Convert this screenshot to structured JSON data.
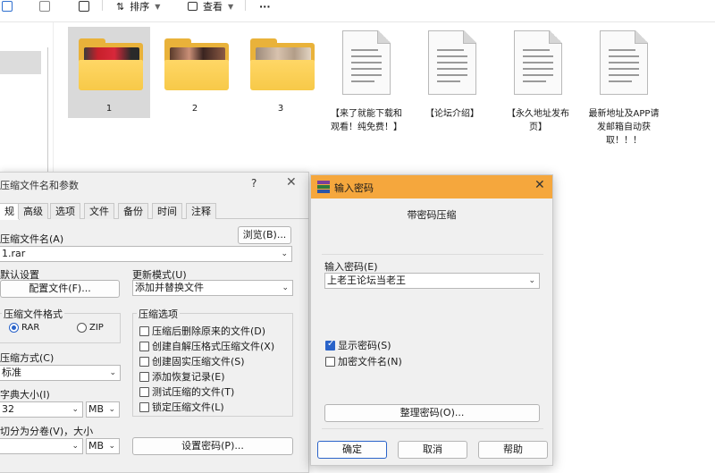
{
  "toolbar": {
    "sort_label": "排序",
    "view_label": "查看",
    "more_label": "···"
  },
  "files": [
    {
      "name": "1",
      "type": "folder",
      "selected": true
    },
    {
      "name": "2",
      "type": "folder",
      "selected": false
    },
    {
      "name": "3",
      "type": "folder",
      "selected": false
    },
    {
      "name": "【来了就能下载和观看！纯免费！】",
      "type": "document"
    },
    {
      "name": "【论坛介绍】",
      "type": "document"
    },
    {
      "name": "【永久地址发布页】",
      "type": "document"
    },
    {
      "name": "最新地址及APP请发邮箱自动获取！！！",
      "type": "document"
    }
  ],
  "archive_dialog": {
    "title": "压缩文件名和参数",
    "help_label": "?",
    "close_label": "✕",
    "tabs": [
      "规",
      "高级",
      "选项",
      "文件",
      "备份",
      "时间",
      "注释"
    ],
    "archive_name_label": "压缩文件名(A)",
    "browse_button": "浏览(B)...",
    "archive_name_value": "1.rar",
    "default_settings_label": "默认设置",
    "profiles_button": "配置文件(F)...",
    "update_mode_label": "更新模式(U)",
    "update_mode_value": "添加并替换文件",
    "format_group_label": "压缩文件格式",
    "format_rar": "RAR",
    "format_zip": "ZIP",
    "format_selected": "RAR",
    "options_group_label": "压缩选项",
    "options": [
      {
        "label": "压缩后删除原来的文件(D)",
        "checked": false
      },
      {
        "label": "创建自解压格式压缩文件(X)",
        "checked": false
      },
      {
        "label": "创建固实压缩文件(S)",
        "checked": false
      },
      {
        "label": "添加恢复记录(E)",
        "checked": false
      },
      {
        "label": "测试压缩的文件(T)",
        "checked": false
      },
      {
        "label": "锁定压缩文件(L)",
        "checked": false
      }
    ],
    "method_label": "压缩方式(C)",
    "method_value": "标准",
    "dict_label": "字典大小(I)",
    "dict_value": "32",
    "dict_unit": "MB",
    "split_label": "切分为分卷(V)，大小",
    "split_unit": "MB",
    "set_password_button": "设置密码(P)..."
  },
  "password_dialog": {
    "title": "输入密码",
    "close_label": "✕",
    "heading": "带密码压缩",
    "enter_password_label": "输入密码(E)",
    "password_value": "上老王论坛当老王",
    "show_password_label": "显示密码(S)",
    "show_password_checked": true,
    "encrypt_names_label": "加密文件名(N)",
    "encrypt_names_checked": false,
    "organize_button": "整理密码(O)...",
    "ok_button": "确定",
    "cancel_button": "取消",
    "help_button": "帮助",
    "titlebar_color": "#f5a73d"
  }
}
